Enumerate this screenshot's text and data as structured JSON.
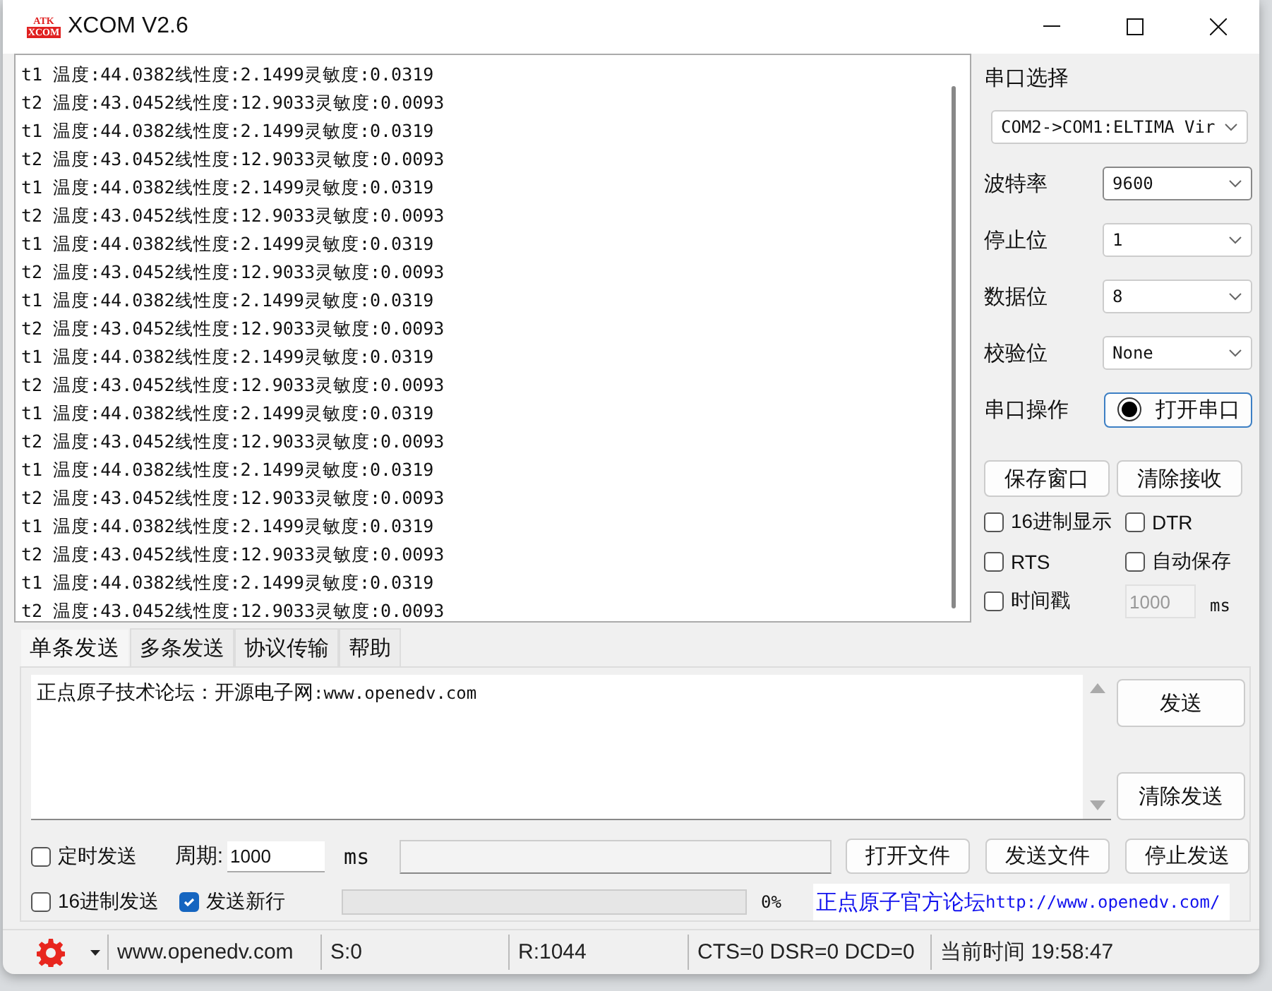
{
  "window": {
    "title": "XCOM V2.6",
    "logo_top": "ATK",
    "logo_bottom": "XCOM"
  },
  "receive": {
    "lines": [
      "t1 温度:44.0382线性度:2.1499灵敏度:0.0319",
      "t2 温度:43.0452线性度:12.9033灵敏度:0.0093",
      "t1 温度:44.0382线性度:2.1499灵敏度:0.0319",
      "t2 温度:43.0452线性度:12.9033灵敏度:0.0093",
      "t1 温度:44.0382线性度:2.1499灵敏度:0.0319",
      "t2 温度:43.0452线性度:12.9033灵敏度:0.0093",
      "t1 温度:44.0382线性度:2.1499灵敏度:0.0319",
      "t2 温度:43.0452线性度:12.9033灵敏度:0.0093",
      "t1 温度:44.0382线性度:2.1499灵敏度:0.0319",
      "t2 温度:43.0452线性度:12.9033灵敏度:0.0093",
      "t1 温度:44.0382线性度:2.1499灵敏度:0.0319",
      "t2 温度:43.0452线性度:12.9033灵敏度:0.0093",
      "t1 温度:44.0382线性度:2.1499灵敏度:0.0319",
      "t2 温度:43.0452线性度:12.9033灵敏度:0.0093",
      "t1 温度:44.0382线性度:2.1499灵敏度:0.0319",
      "t2 温度:43.0452线性度:12.9033灵敏度:0.0093",
      "t1 温度:44.0382线性度:2.1499灵敏度:0.0319",
      "t2 温度:43.0452线性度:12.9033灵敏度:0.0093",
      "t1 温度:44.0382线性度:2.1499灵敏度:0.0319",
      "t2 温度:43.0452线性度:12.9033灵敏度:0.0093"
    ]
  },
  "serial": {
    "port_label": "串口选择",
    "port": "COM2->COM1:ELTIMA Vir",
    "settings": [
      {
        "label": "波特率",
        "value": "9600"
      },
      {
        "label": "停止位",
        "value": "1"
      },
      {
        "label": "数据位",
        "value": "8"
      },
      {
        "label": "校验位",
        "value": "None"
      }
    ],
    "operation_label": "串口操作",
    "open_button": "打开串口",
    "buttons": [
      "保存窗口",
      "清除接收"
    ],
    "options": [
      {
        "label": "16进制显示",
        "checked": false
      },
      {
        "label": "DTR",
        "checked": false
      },
      {
        "label": "RTS",
        "checked": false
      },
      {
        "label": "自动保存",
        "checked": false
      },
      {
        "label": "时间戳",
        "checked": false
      }
    ],
    "timestamp_ms": {
      "value": "1000",
      "disabled": true,
      "unit": "ms"
    }
  },
  "tabs": [
    {
      "label": "单条发送",
      "selected": true
    },
    {
      "label": "多条发送",
      "selected": false
    },
    {
      "label": "协议传输",
      "selected": false
    },
    {
      "label": "帮助",
      "selected": false
    }
  ],
  "send": {
    "text": "正点原子技术论坛：开源电子网:www.openedv.com",
    "send_button": "发送",
    "clear_button": "清除发送",
    "timed": {
      "label": "定时发送",
      "checked": false
    },
    "period_label": "周期:",
    "period": "1000",
    "period_unit": "ms",
    "file_buttons": [
      "打开文件",
      "发送文件",
      "停止发送"
    ],
    "hex": {
      "label": "16进制发送",
      "checked": false
    },
    "newline": {
      "label": "发送新行",
      "checked": true
    },
    "progress": {
      "level": 0,
      "reading": "0%"
    },
    "link": "正点原子官方论坛http://www.openedv.com/"
  },
  "status_bar": {
    "site": "www.openedv.com",
    "sent": "S:0",
    "received": "R:1044",
    "lines": "CTS=0 DSR=0 DCD=0",
    "time": "当前时间 19:58:47"
  }
}
